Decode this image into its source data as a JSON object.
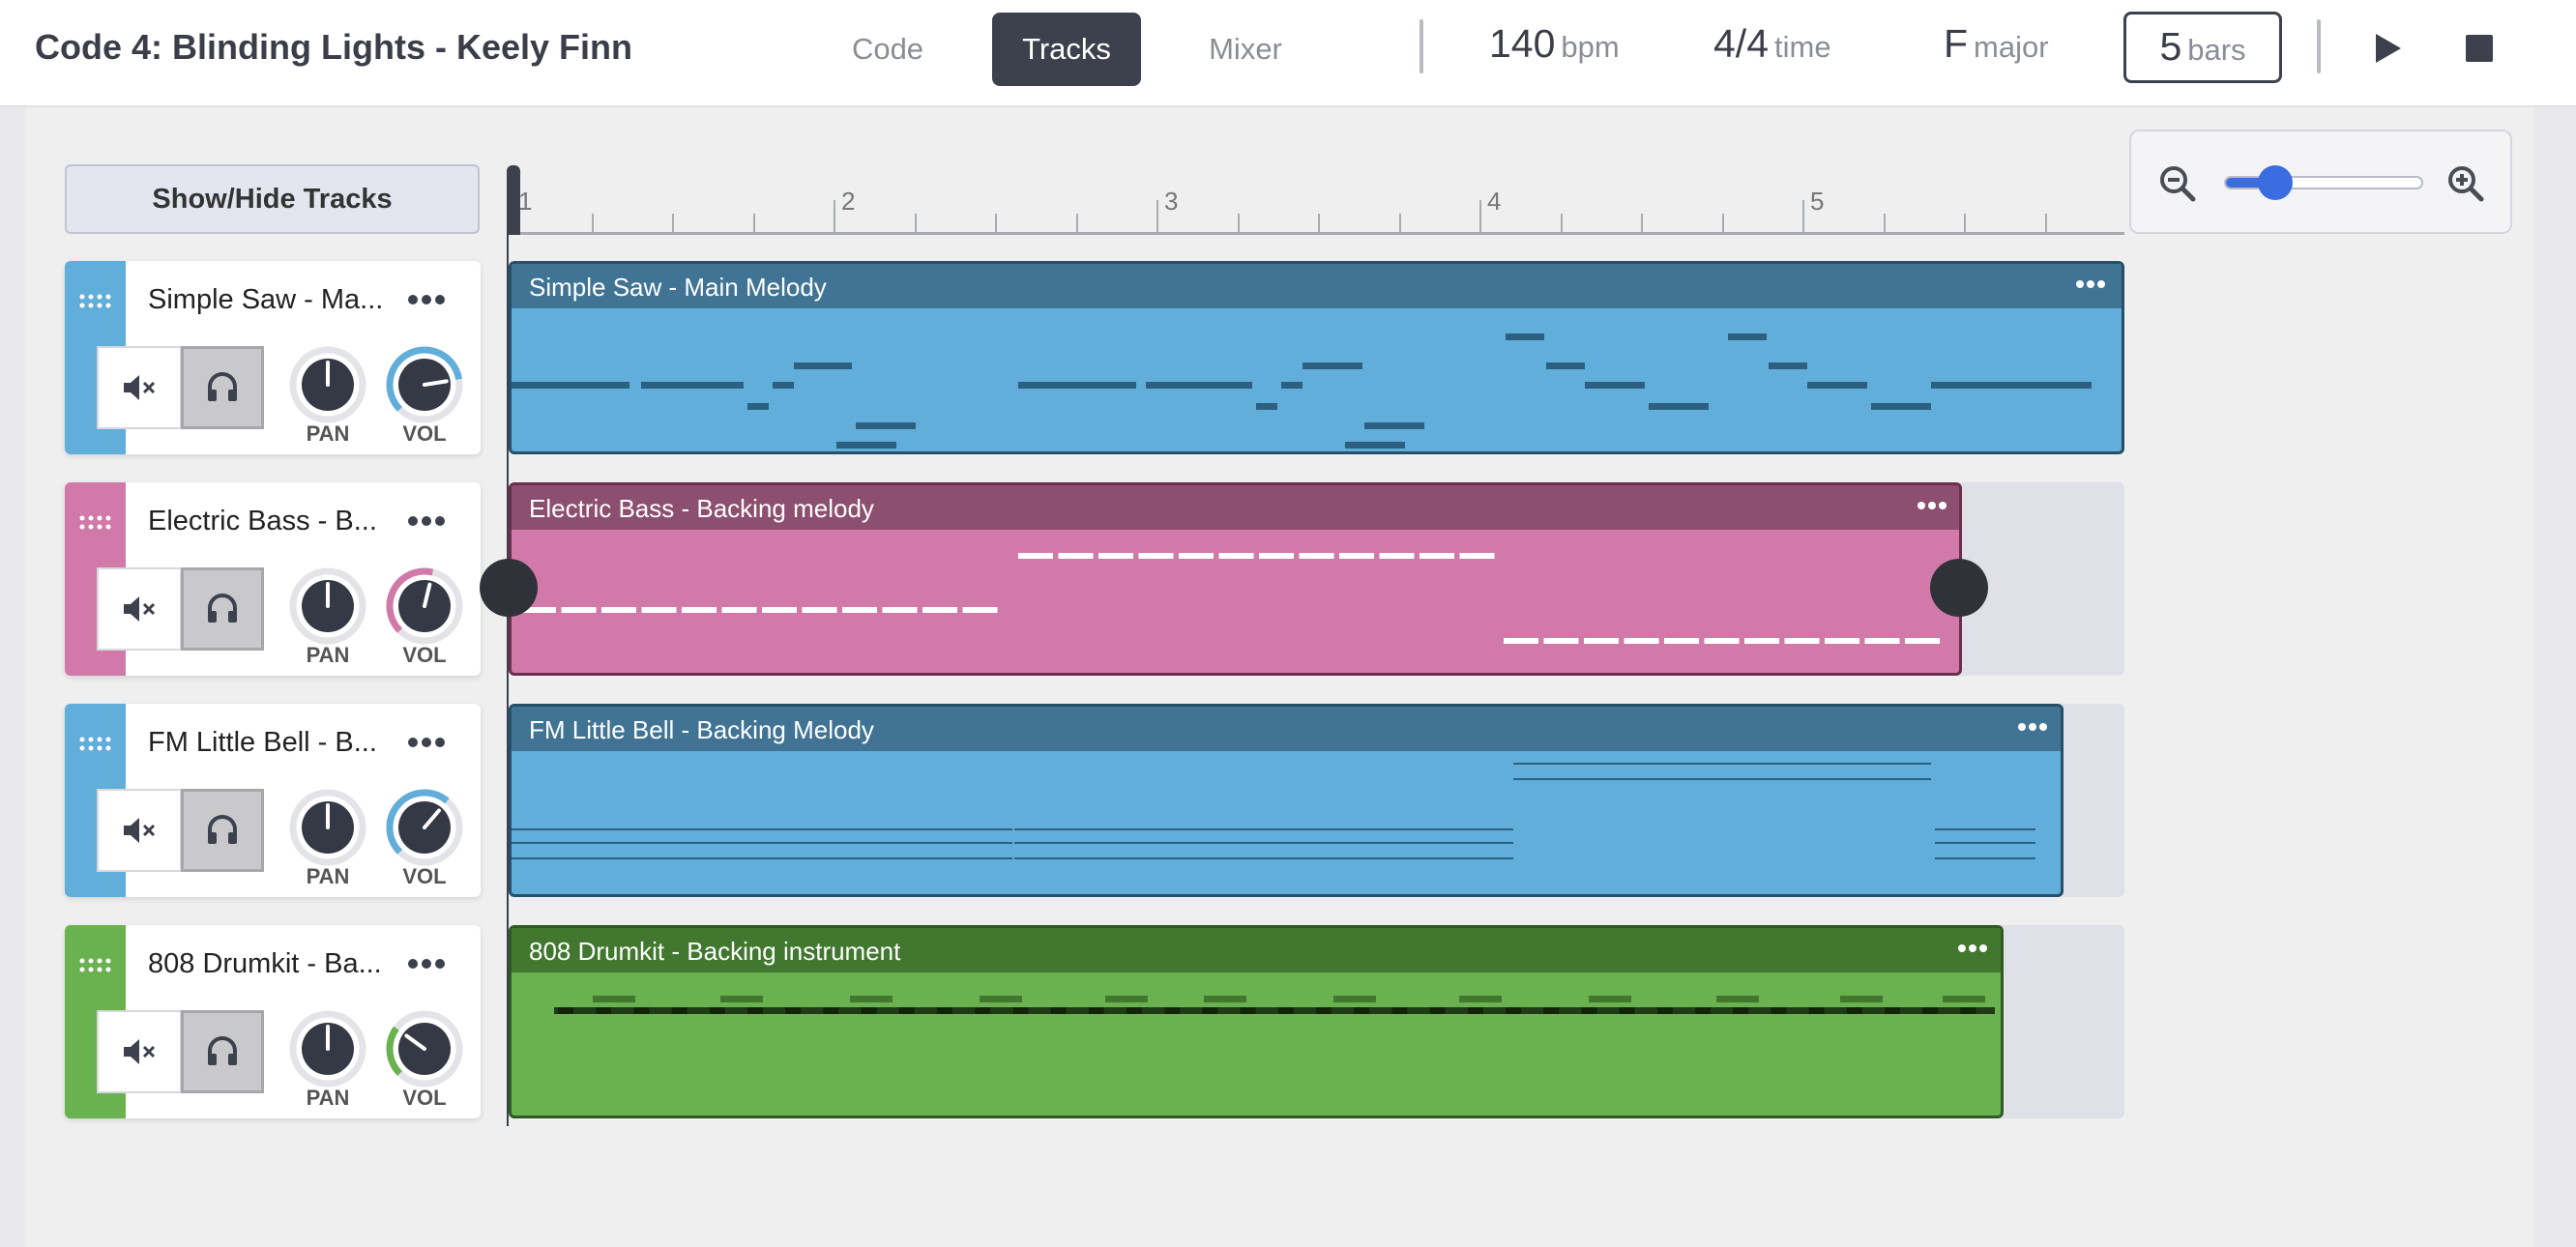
{
  "header": {
    "title": "Code 4: Blinding Lights - Keely Finn",
    "tabs": [
      {
        "label": "Code",
        "active": false
      },
      {
        "label": "Tracks",
        "active": true
      },
      {
        "label": "Mixer",
        "active": false
      }
    ],
    "tempo": {
      "value": "140",
      "unit": "bpm"
    },
    "time_signature": {
      "value": "4/4",
      "unit": "time"
    },
    "key": {
      "value": "F",
      "unit": "major"
    },
    "length": {
      "value": "5",
      "unit": "bars"
    },
    "play_icon": "play-icon",
    "stop_icon": "stop-icon"
  },
  "toolbar": {
    "show_hide_label": "Show/Hide Tracks",
    "zoom": {
      "level_fraction": 0.25,
      "out_icon": "zoom-out-icon",
      "in_icon": "zoom-in-icon"
    }
  },
  "ruler": {
    "labels": [
      "1",
      "2",
      "3",
      "4",
      "5"
    ]
  },
  "tracks": [
    {
      "name": "Simple Saw - Ma...",
      "color": "#62aedb",
      "pan_label": "PAN",
      "vol_label": "VOL",
      "vol_level": 0.8,
      "clip": {
        "title": "Simple Saw - Main Melody",
        "body_color": "#62aedb",
        "head_color": "#417494",
        "border": "#264f6a",
        "length_bars": 5
      }
    },
    {
      "name": "Electric Bass - B...",
      "color": "#d17aa9",
      "pan_label": "PAN",
      "vol_label": "VOL",
      "vol_level": 0.55,
      "clip": {
        "title": "Electric Bass - Backing melody",
        "body_color": "#d17aa9",
        "head_color": "#8d4f6f",
        "border": "#6b2f4c",
        "length_bars": 4.5
      }
    },
    {
      "name": "FM Little Bell - B...",
      "color": "#62aedb",
      "pan_label": "PAN",
      "vol_label": "VOL",
      "vol_level": 0.65,
      "clip": {
        "title": "FM Little Bell - Backing Melody",
        "body_color": "#62aedb",
        "head_color": "#417494",
        "border": "#264f6a",
        "length_bars": 4.8
      }
    },
    {
      "name": "808 Drumkit - Ba...",
      "color": "#69b24f",
      "pan_label": "PAN",
      "vol_label": "VOL",
      "vol_level": 0.3,
      "clip": {
        "title": "808 Drumkit - Backing instrument",
        "body_color": "#69b24f",
        "head_color": "#42772f",
        "border": "#2f5a21",
        "length_bars": 4.6
      }
    }
  ]
}
